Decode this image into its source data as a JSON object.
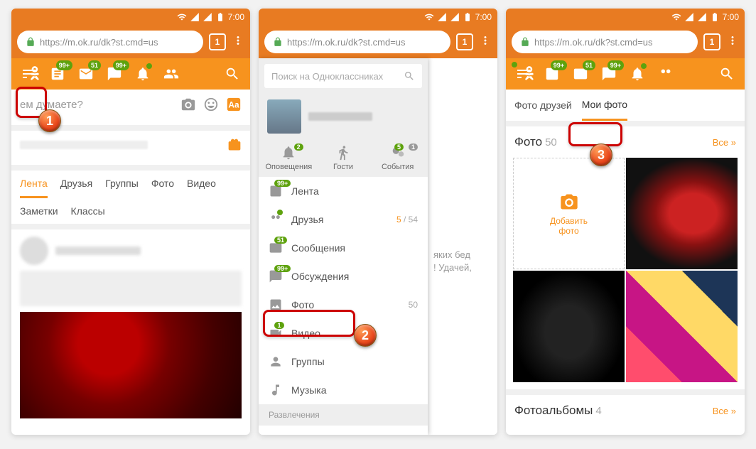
{
  "status": {
    "time": "7:00"
  },
  "chrome": {
    "url": "https://m.ok.ru/dk?st.cmd=us",
    "tab_count": "1"
  },
  "nav": {
    "badge_99": "99+",
    "badge_51": "51"
  },
  "screen1": {
    "composer_prompt": "ем думаете?",
    "tabs": [
      "Лента",
      "Друзья",
      "Группы",
      "Фото",
      "Видео"
    ],
    "tabs2": [
      "Заметки",
      "Классы"
    ]
  },
  "screen2": {
    "search_placeholder": "Поиск на Одноклассниках",
    "topcells": {
      "notifications": "Оповещения",
      "guests": "Гости",
      "events": "События",
      "notif_badge": "2",
      "events_b1": "5",
      "events_b2": "1"
    },
    "menu": {
      "feed": "Лента",
      "friends": "Друзья",
      "friends_count_hi": "5",
      "friends_count_total": " / 54",
      "messages": "Сообщения",
      "discussions": "Обсуждения",
      "photo": "Фото",
      "photo_count": "50",
      "video": "Видео",
      "groups": "Группы",
      "music": "Музыка",
      "section": "Развлечения"
    },
    "peek": "яких бед\n! Удачей,"
  },
  "screen3": {
    "tabs": {
      "friends": "Фото друзей",
      "my": "Мои фото"
    },
    "header": {
      "title": "Фото",
      "count": "50",
      "all": "Все »"
    },
    "add": "Добавить\nфото",
    "albums": {
      "title": "Фотоальбомы",
      "count": "4",
      "all": "Все »"
    }
  }
}
